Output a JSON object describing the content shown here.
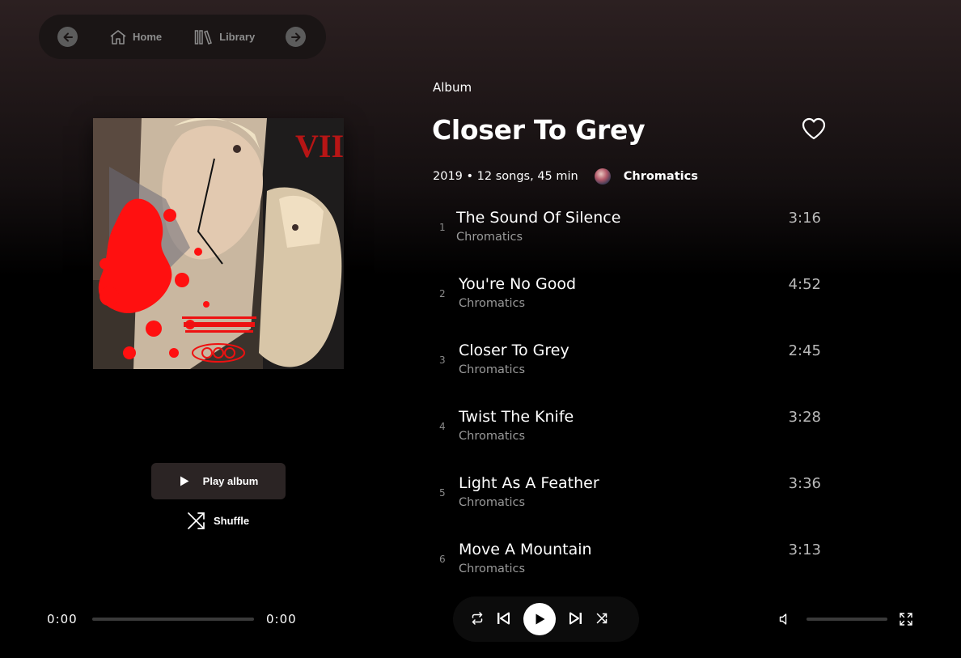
{
  "nav": {
    "home_label": "Home",
    "library_label": "Library"
  },
  "album": {
    "kind": "Album",
    "title": "Closer To Grey",
    "meta": "2019 • 12 songs, 45 min",
    "artist": "Chromatics",
    "cover_text": "VII"
  },
  "actions": {
    "play_label": "Play album",
    "shuffle_label": "Shuffle"
  },
  "tracks": [
    {
      "num": "1",
      "title": "The Sound Of Silence",
      "artist": "Chromatics",
      "duration": "3:16"
    },
    {
      "num": "2",
      "title": "You're No Good",
      "artist": "Chromatics",
      "duration": "4:52"
    },
    {
      "num": "3",
      "title": "Closer To Grey",
      "artist": "Chromatics",
      "duration": "2:45"
    },
    {
      "num": "4",
      "title": "Twist The Knife",
      "artist": "Chromatics",
      "duration": "3:28"
    },
    {
      "num": "5",
      "title": "Light As A Feather",
      "artist": "Chromatics",
      "duration": "3:36"
    },
    {
      "num": "6",
      "title": "Move A Mountain",
      "artist": "Chromatics",
      "duration": "3:13"
    }
  ],
  "player": {
    "elapsed": "0:00",
    "total": "0:00",
    "progress": 0,
    "volume": 0
  },
  "icons": [
    "back-arrow-icon",
    "home-icon",
    "library-icon",
    "forward-arrow-icon",
    "heart-icon",
    "play-icon",
    "shuffle-icon",
    "repeat-icon",
    "previous-icon",
    "next-icon",
    "volume-icon",
    "fullscreen-icon"
  ],
  "colors": {
    "background_top": "#2c2021",
    "background": "#000000",
    "button_bg": "#2b2424",
    "cover_red": "#ff1010"
  }
}
